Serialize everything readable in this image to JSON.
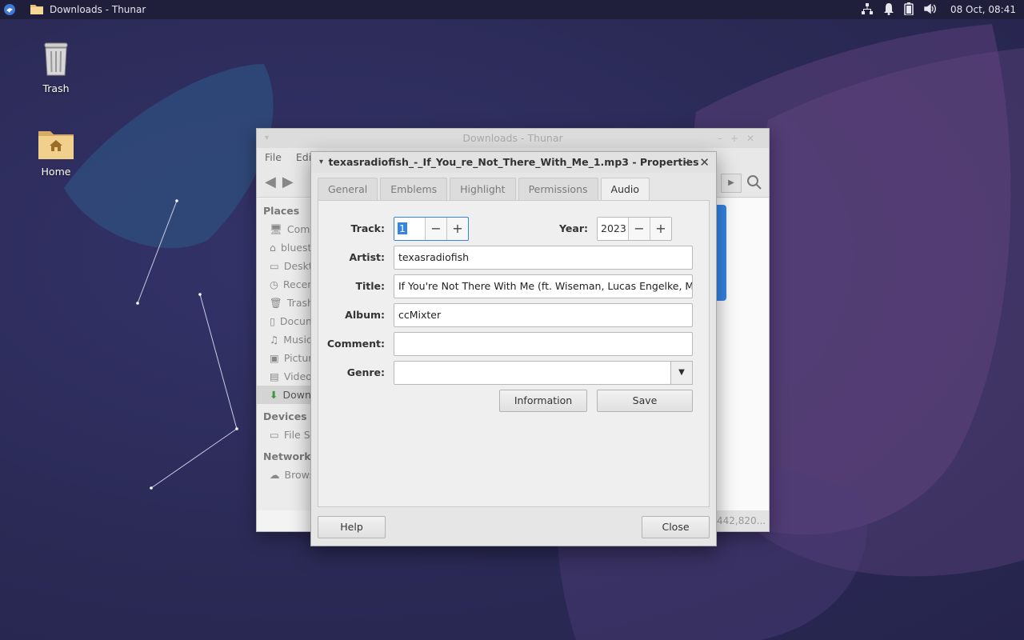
{
  "panel": {
    "window_title": "Downloads - Thunar",
    "clock": "08 Oct, 08:41"
  },
  "desktop": {
    "trash_label": "Trash",
    "home_label": "Home"
  },
  "thunar": {
    "title": "Downloads - Thunar",
    "menu": [
      "File",
      "Edit"
    ],
    "sidebar": {
      "places_title": "Places",
      "devices_title": "Devices",
      "network_title": "Network",
      "items": [
        "Computer",
        "bluestar",
        "Desktop",
        "Recent",
        "Trash",
        "Documents",
        "Music",
        "Pictures",
        "Videos",
        "Downloads"
      ],
      "devices": [
        "File System"
      ],
      "network": [
        "Browse Network"
      ]
    },
    "status": "442,820..."
  },
  "dialog": {
    "title": "texasradiofish_-_If_You_re_Not_There_With_Me_1.mp3 - Properties",
    "tabs": [
      "General",
      "Emblems",
      "Highlight",
      "Permissions",
      "Audio"
    ],
    "active_tab": "Audio",
    "labels": {
      "track": "Track:",
      "year": "Year:",
      "artist": "Artist:",
      "title": "Title:",
      "album": "Album:",
      "comment": "Comment:",
      "genre": "Genre:"
    },
    "values": {
      "track": "1",
      "year": "2023",
      "artist": "texasradiofish",
      "title": "If You're Not There With Me (ft. Wiseman, Lucas Engelke, Milkdad",
      "album": "ccMixter",
      "comment": "",
      "genre": ""
    },
    "buttons": {
      "information": "Information",
      "save": "Save",
      "help": "Help",
      "close": "Close"
    }
  },
  "colors": {
    "accent": "#3584e4",
    "panel_bg": "#1f1e3b",
    "desktop_bg": "#2c2b57"
  }
}
